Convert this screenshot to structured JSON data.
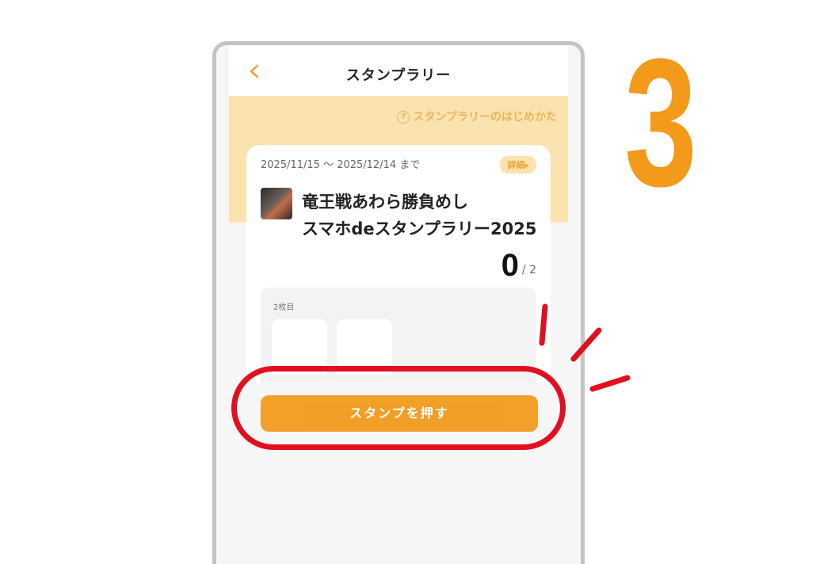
{
  "step_number": "3",
  "app": {
    "title": "スタンプラリー",
    "howto_link": "スタンプラリーのはじめかた",
    "howto_icon": "question-circle-icon"
  },
  "rally": {
    "dates": "2025/11/15 〜 2025/12/14 まで",
    "detail_label": "詳細▸",
    "title_line1": "竜王戦あわら勝負めし",
    "title_line2": "スマホdeスタンプラリー2025",
    "count": "0",
    "total": "/ 2",
    "sheet_label": "2枚目"
  },
  "actions": {
    "stamp_button": "スタンプを押す"
  },
  "colors": {
    "accent": "#f39a1b",
    "banner": "#fbe3b0",
    "highlight": "#e2101f"
  }
}
